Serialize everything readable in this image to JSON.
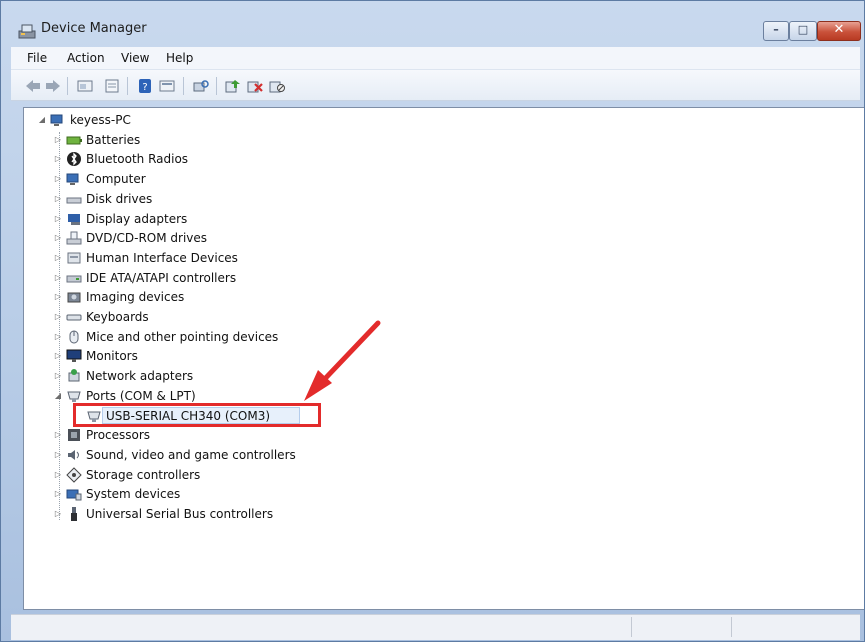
{
  "window": {
    "title": "Device Manager"
  },
  "menubar": {
    "items": [
      "File",
      "Action",
      "View",
      "Help"
    ]
  },
  "toolbar": {
    "icons": [
      "back-icon",
      "forward-icon",
      "show-hide-icon",
      "properties-icon",
      "help-icon",
      "view-icon",
      "scan-hardware-icon",
      "update-driver-icon",
      "uninstall-icon",
      "disable-icon"
    ]
  },
  "tree": {
    "root": "keyess-PC",
    "categories": [
      {
        "label": "Batteries",
        "icon": "battery-icon",
        "expanded": false
      },
      {
        "label": "Bluetooth Radios",
        "icon": "bluetooth-icon",
        "expanded": false
      },
      {
        "label": "Computer",
        "icon": "computer-icon",
        "expanded": false
      },
      {
        "label": "Disk drives",
        "icon": "disk-drive-icon",
        "expanded": false
      },
      {
        "label": "Display adapters",
        "icon": "display-adapter-icon",
        "expanded": false
      },
      {
        "label": "DVD/CD-ROM drives",
        "icon": "dvd-drive-icon",
        "expanded": false
      },
      {
        "label": "Human Interface Devices",
        "icon": "hid-icon",
        "expanded": false
      },
      {
        "label": "IDE ATA/ATAPI controllers",
        "icon": "ide-controller-icon",
        "expanded": false
      },
      {
        "label": "Imaging devices",
        "icon": "imaging-device-icon",
        "expanded": false
      },
      {
        "label": "Keyboards",
        "icon": "keyboard-icon",
        "expanded": false
      },
      {
        "label": "Mice and other pointing devices",
        "icon": "mouse-icon",
        "expanded": false
      },
      {
        "label": "Monitors",
        "icon": "monitor-icon",
        "expanded": false
      },
      {
        "label": "Network adapters",
        "icon": "network-adapter-icon",
        "expanded": false
      },
      {
        "label": "Ports (COM & LPT)",
        "icon": "port-icon",
        "expanded": true,
        "children": [
          {
            "label": "USB-SERIAL CH340 (COM3)",
            "icon": "port-icon",
            "selected": true
          }
        ]
      },
      {
        "label": "Processors",
        "icon": "processor-icon",
        "expanded": false
      },
      {
        "label": "Sound, video and game controllers",
        "icon": "sound-icon",
        "expanded": false
      },
      {
        "label": "Storage controllers",
        "icon": "storage-controller-icon",
        "expanded": false
      },
      {
        "label": "System devices",
        "icon": "system-device-icon",
        "expanded": false
      },
      {
        "label": "Universal Serial Bus controllers",
        "icon": "usb-icon",
        "expanded": false
      }
    ]
  },
  "annotation": {
    "highlight_color": "#e32b2b",
    "arrow_color": "#e32b2b"
  },
  "colors": {
    "window_frame": "#b6cbe6",
    "close_button": "#c9523b"
  }
}
